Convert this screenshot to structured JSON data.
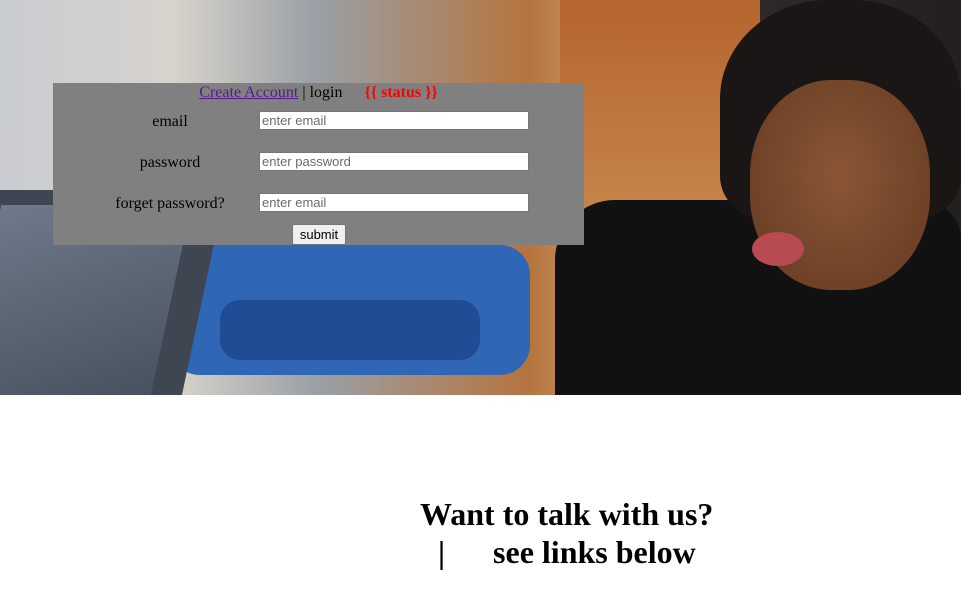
{
  "login": {
    "nav": {
      "create_account": "Create Account",
      "separator": "|",
      "login": "login",
      "status": "{{ status }}"
    },
    "fields": [
      {
        "label": "email",
        "placeholder": "enter email",
        "value": ""
      },
      {
        "label": "password",
        "placeholder": "enter password",
        "value": ""
      },
      {
        "label": "forget password?",
        "placeholder": "enter email",
        "value": ""
      }
    ],
    "submit_label": "submit"
  },
  "contact": {
    "heading": "Want to talk with us?",
    "separator": "|",
    "subheading": "see links below"
  },
  "colors": {
    "panel": "#808080",
    "status": "#ff0000",
    "link": "#551a8b"
  }
}
